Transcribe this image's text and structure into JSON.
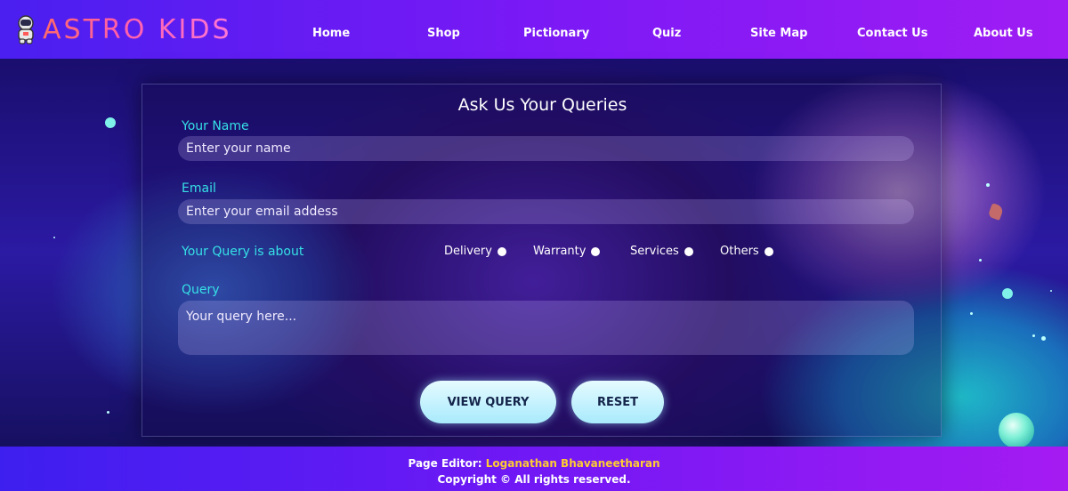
{
  "header": {
    "logo_text": "ASTRO KIDS",
    "nav": [
      {
        "label": "Home"
      },
      {
        "label": "Shop"
      },
      {
        "label": "Pictionary"
      },
      {
        "label": "Quiz"
      },
      {
        "label": "Site Map"
      },
      {
        "label": "Contact Us"
      },
      {
        "label": "About Us"
      }
    ]
  },
  "form": {
    "title": "Ask Us Your Queries",
    "name_label": "Your Name",
    "name_placeholder": "Enter your name",
    "email_label": "Email",
    "email_placeholder": "Enter your email addess",
    "query_about_label": "Your Query is about",
    "options": [
      {
        "label": "Delivery"
      },
      {
        "label": "Warranty"
      },
      {
        "label": "Services"
      },
      {
        "label": "Others"
      }
    ],
    "query_label": "Query",
    "query_placeholder": "Your query here...",
    "view_button": "VIEW QUERY",
    "reset_button": "RESET"
  },
  "footer": {
    "editor_prefix": "Page Editor: ",
    "editor_name": "Loganathan Bhavaneetharan",
    "copyright": "Copyright © All rights reserved."
  },
  "colors": {
    "header_gradient_start": "#4a1ff0",
    "header_gradient_end": "#a01cf4",
    "label_cyan": "#36e0e6",
    "button_bg": "#bdf1fd",
    "editor_name": "#ffcc33"
  }
}
